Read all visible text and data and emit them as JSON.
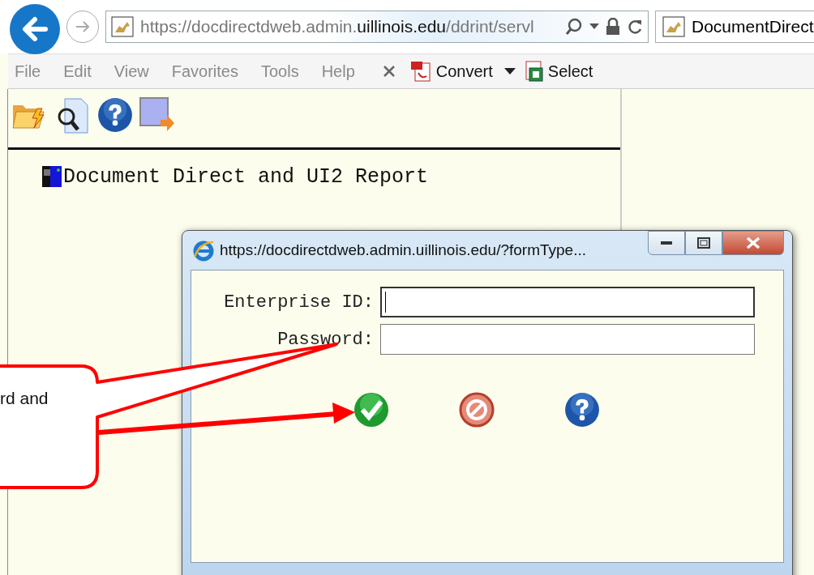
{
  "browser": {
    "address": {
      "start": "https://docdirectdweb.admin.",
      "domain": "uillinois.edu",
      "path": "/ddrint/servl"
    },
    "tab": {
      "title": "DocumentDirect"
    }
  },
  "menu_bar": {
    "items": [
      {
        "label": "File",
        "disabled": true
      },
      {
        "label": "Edit",
        "disabled": true
      },
      {
        "label": "View",
        "disabled": true
      },
      {
        "label": "Favorites",
        "disabled": true
      },
      {
        "label": "Tools",
        "disabled": true
      },
      {
        "label": "Help",
        "disabled": true
      }
    ],
    "convert": "Convert",
    "select": "Select"
  },
  "frame": {
    "tree": [
      {
        "label": "Document Direct and UI2 Report"
      }
    ]
  },
  "popup": {
    "title": "https://docdirectdweb.admin.uillinois.edu/?formType...",
    "fields": [
      {
        "label": "Enterprise ID:",
        "focused": true
      },
      {
        "label": "Password:",
        "focused": false
      }
    ]
  },
  "callout": {
    "text": "rd and"
  }
}
